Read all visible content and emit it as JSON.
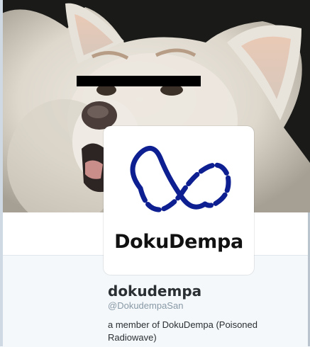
{
  "profile": {
    "display_name": "dokudempa",
    "handle": "@DokudempaSan",
    "bio_lines": [
      "a member of DokuDempa (Poisoned",
      "Radiowave)"
    ]
  },
  "avatar": {
    "logo_text": "DokuDempa",
    "logo_color": "#0d1f91"
  },
  "header": {
    "image": "white-dog-photo",
    "censor_bar_color": "#000000"
  },
  "colors": {
    "profile_bg": "#f5f8fa",
    "name": "#292f33",
    "handle": "#8899a6"
  }
}
